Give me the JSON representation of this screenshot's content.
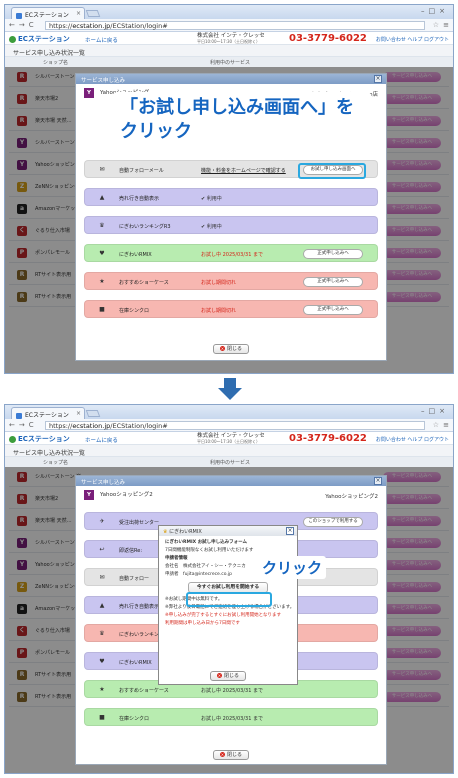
{
  "browser": {
    "tab_title": "ECステーション",
    "url_prefix": "https://",
    "url_host": "ecstation.jp",
    "url_path": "/ECStation/login#"
  },
  "site": {
    "logo": "ECステーション",
    "home": "ホームに戻る",
    "company": "株式会社 インテ・クレッセ",
    "hours": "平日10:00〜17:30（土日祝除く）",
    "phone": "03-3779-6022",
    "links": "お問い合わせ  ヘルプ  ログアウト",
    "page_title": "サービス申し込み状況一覧",
    "col_shop": "ショップ名",
    "col_service": "利用中のサービス"
  },
  "shops": [
    {
      "name": "シルバーストーン 楽",
      "icon": "R",
      "color": "#c0282d"
    },
    {
      "name": "楽天市場2",
      "icon": "R",
      "color": "#c0282d"
    },
    {
      "name": "楽天市場 天然…",
      "icon": "R",
      "color": "#c0282d"
    },
    {
      "name": "シルバーストーンY",
      "icon": "Y",
      "color": "#7a1f7a"
    },
    {
      "name": "Yahooショッピング",
      "icon": "Y",
      "color": "#7a1f7a"
    },
    {
      "name": "ZeNNショッピング",
      "icon": "Z",
      "color": "#d9a21a"
    },
    {
      "name": "Amazonマーケット",
      "icon": "a",
      "color": "#222222"
    },
    {
      "name": "ぐるり仕入市場",
      "icon": "く",
      "color": "#c0282d"
    },
    {
      "name": "ポンパレモール",
      "icon": "P",
      "color": "#c0282d"
    },
    {
      "name": "RTサイト表示用",
      "icon": "R",
      "color": "#8a6a2a"
    },
    {
      "name": "RTサイト表示用",
      "icon": "R",
      "color": "#8a6a2a"
    }
  ],
  "shop_button": "サービス申し込みへ",
  "modal1": {
    "title": "サービス申し込み",
    "shop": "Yahooショッピング",
    "shop_right": "シルバーストーン Yahoo店",
    "services": [
      {
        "name": "自動フォローメール",
        "status": "機能・料金をホームページで確認する",
        "button": "お試し申し込み画面へ",
        "color": "gray",
        "icon": "✉",
        "status_style": "uline"
      },
      {
        "name": "売れ行き自動表示",
        "status": "✔ 利用中",
        "button": "",
        "color": "purple",
        "icon": "▲",
        "status_style": ""
      },
      {
        "name": "にぎわいランキングR3",
        "status": "✔ 利用中",
        "button": "",
        "color": "purple",
        "icon": "♛",
        "status_style": ""
      },
      {
        "name": "にぎわいRMIX",
        "status": "お試し中 2025/03/31 まで",
        "button": "正式申し込みへ",
        "color": "green",
        "icon": "♥",
        "status_style": "red"
      },
      {
        "name": "おすすめショーケース",
        "status": "お試し期間切れ",
        "button": "正式申し込みへ",
        "color": "pink",
        "icon": "★",
        "status_style": "red"
      },
      {
        "name": "在庫シンクロ",
        "status": "お試し期間切れ",
        "button": "正式申し込みへ",
        "color": "pink",
        "icon": "■",
        "status_style": "red"
      }
    ],
    "close": "閉じる"
  },
  "callout1": "「お試し申し込み画面へ」をクリック",
  "modal2": {
    "title": "サービス申し込み",
    "shop": "Yahooショッピング2",
    "shop_right": "Yahooショッピング2",
    "services": [
      {
        "name": "受注出荷センター",
        "status": "",
        "button": "このショップで利用する",
        "color": "purple",
        "icon": "✈"
      },
      {
        "name": "即返信Re:",
        "status": "",
        "button": "",
        "color": "purple",
        "icon": "↩"
      },
      {
        "name": "自動フォロー",
        "status": "",
        "button": "",
        "color": "gray",
        "icon": "✉"
      },
      {
        "name": "売れ行き自動表示",
        "status": "",
        "button": "",
        "color": "purple",
        "icon": "▲"
      },
      {
        "name": "にぎわいランキング",
        "status": "",
        "button": "",
        "color": "pink",
        "icon": "♛"
      },
      {
        "name": "にぎわいRMIX",
        "status": "",
        "button": "",
        "color": "purple",
        "icon": "♥"
      },
      {
        "name": "おすすめショーケース",
        "status": "お試し中 2025/03/31 まで",
        "button": "",
        "color": "green",
        "icon": "★"
      },
      {
        "name": "在庫シンクロ",
        "status": "お試し中 2025/03/31 まで",
        "button": "",
        "color": "green",
        "icon": "■"
      }
    ],
    "close": "閉じる"
  },
  "inner": {
    "title": "にぎわいRMIX",
    "heading": "にぎわいRMIX お試し申し込みフォーム",
    "sub": "7日間機能制限なくお試し利用いただけます",
    "applicant": "申請者情報",
    "company_label": "会社名",
    "company_value": "株式会社アイ・シー・テクニカ",
    "person_label": "申請者",
    "person_value": "fujita@intecrece.co.jp",
    "start": "今すぐお試し利用を開始する",
    "note1": "※お試し期間中は無料です。",
    "note2": "※弊社より後日電話にてご連絡を差し上げる場合がございます。",
    "note3": "※申し込みが完了するとすぐにお試し利用開始となります",
    "note4": "利用期間は申し込み日から7日間です",
    "close": "閉じる"
  },
  "callout2": "クリック"
}
